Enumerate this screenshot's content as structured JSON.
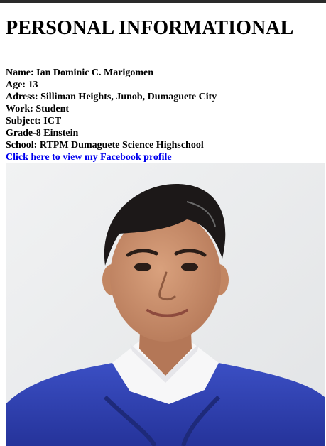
{
  "page": {
    "title": "PERSONAL INFORMATIONAL"
  },
  "info": {
    "name": "Name: Ian Dominic C. Marigomen",
    "age": "Age: 13",
    "address": "Adress: Silliman Heights, Junob, Dumaguete City",
    "work": "Work: Student",
    "subject": "Subject: ICT",
    "grade": "Grade-8 Einstein",
    "school": "School: RTPM Dumaguete Science Highschool"
  },
  "link": {
    "label": "Click here to view my Facebook profile"
  },
  "colors": {
    "link": "#0000ee",
    "uniform": "#2f3fb0",
    "background": "#eceeef"
  }
}
